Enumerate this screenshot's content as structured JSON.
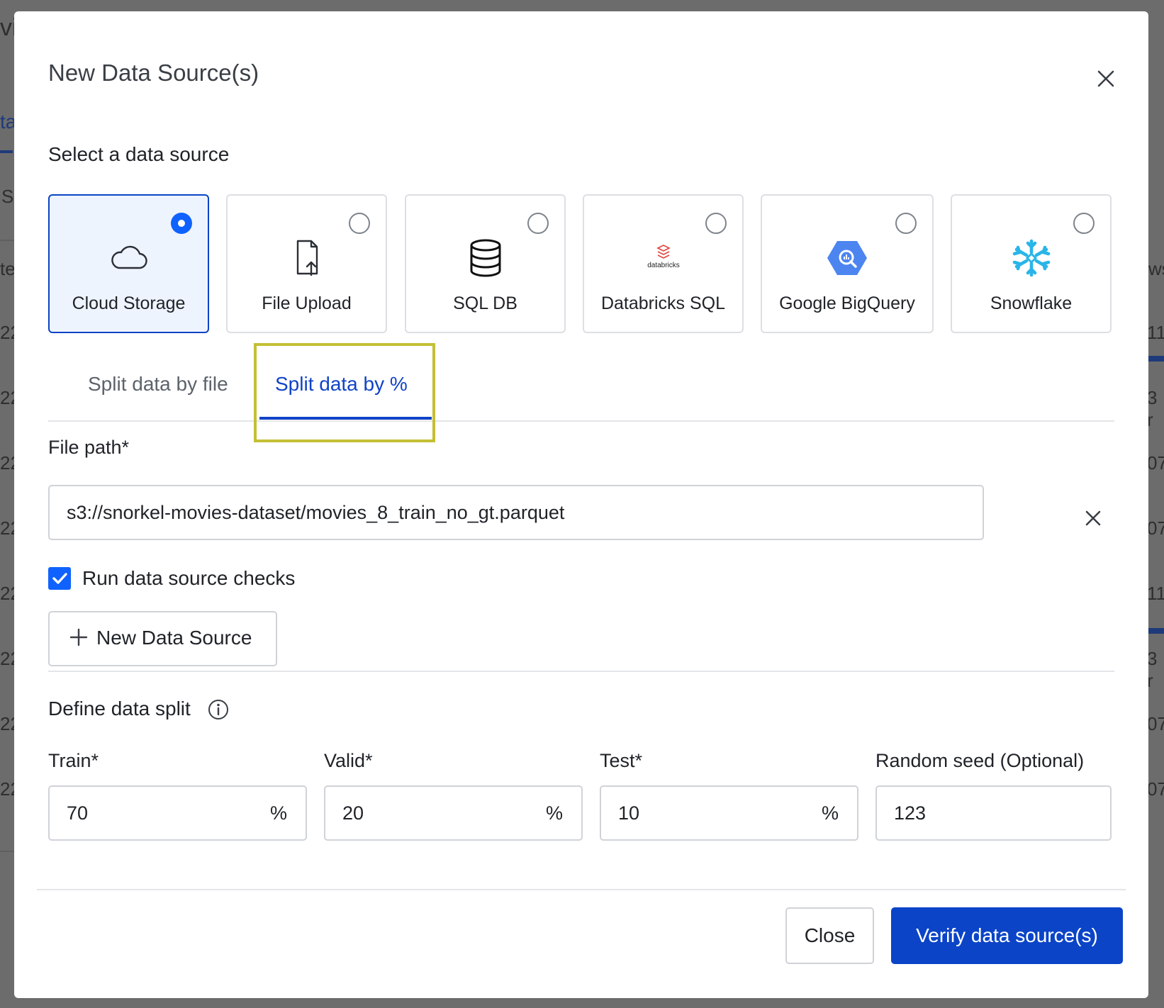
{
  "background": {
    "fragments": [
      "vi",
      "ta",
      "S",
      "te",
      "ws",
      "22",
      "11",
      "3 r",
      "07"
    ]
  },
  "modal": {
    "title": "New Data Source(s)",
    "close_icon": "close-icon",
    "section_label": "Select a data source",
    "sources": [
      {
        "label": "Cloud Storage",
        "icon": "cloud-icon",
        "selected": true
      },
      {
        "label": "File Upload",
        "icon": "file-upload-icon",
        "selected": false
      },
      {
        "label": "SQL DB",
        "icon": "database-icon",
        "selected": false
      },
      {
        "label": "Databricks SQL",
        "icon": "databricks-logo",
        "logo_text": "databricks",
        "selected": false
      },
      {
        "label": "Google BigQuery",
        "icon": "bigquery-logo",
        "selected": false
      },
      {
        "label": "Snowflake",
        "icon": "snowflake-logo",
        "selected": false
      }
    ],
    "tabs": [
      {
        "label": "Split data by file",
        "active": false
      },
      {
        "label": "Split data by %",
        "active": true
      }
    ],
    "file_path": {
      "label": "File path*",
      "value": "s3://snorkel-movies-dataset/movies_8_train_no_gt.parquet"
    },
    "run_checks": {
      "label": "Run data source checks",
      "checked": true
    },
    "new_source_button": "New Data Source",
    "define_split_label": "Define data split",
    "split_fields": [
      {
        "label": "Train*",
        "value": "70",
        "unit": "%"
      },
      {
        "label": "Valid*",
        "value": "20",
        "unit": "%"
      },
      {
        "label": "Test*",
        "value": "10",
        "unit": "%"
      },
      {
        "label": "Random seed (Optional)",
        "value": "123",
        "unit": ""
      }
    ],
    "buttons": {
      "close": "Close",
      "verify": "Verify data source(s)"
    }
  },
  "colors": {
    "accent": "#0b44c7",
    "selected_bg": "#eef4fe",
    "highlight": "#c3bf35",
    "bigquery": "#4c85f0",
    "snowflake": "#29b5e8",
    "databricks": "#e0443e"
  }
}
